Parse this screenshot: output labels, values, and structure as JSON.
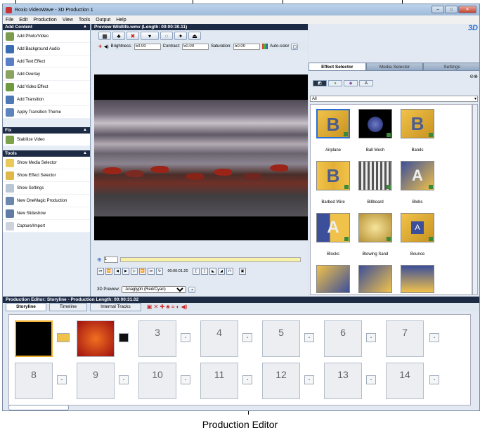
{
  "window": {
    "title": "Roxio VideoWave - 3D Production 1",
    "controls": {
      "minimize": "–",
      "maximize": "□",
      "close": "✕"
    }
  },
  "menu": [
    "File",
    "Edit",
    "Production",
    "View",
    "Tools",
    "Output",
    "Help"
  ],
  "left_panel": {
    "add_content": {
      "header": "Add Content",
      "items": [
        "Add Photo/Video",
        "Add Background Audio",
        "Add Text Effect",
        "Add Overlay",
        "Add Video Effect",
        "Add Transition",
        "Apply Transition Theme"
      ]
    },
    "fix": {
      "header": "Fix",
      "items": [
        "Stabilize Video"
      ]
    },
    "tools": {
      "header": "Tools",
      "items": [
        "Show Media Selector",
        "Show Effect Selector",
        "Show Settings",
        "New OneMagic Production",
        "New Slideshow",
        "Capture/Import"
      ]
    }
  },
  "preview": {
    "header": "Preview  Wildlife.wmv (Length: 00:00:30.11)",
    "brightness_label": "Brightness:",
    "brightness_value": "50.00",
    "contrast_label": "Contrast:",
    "contrast_value": "50.00",
    "saturation_label": "Saturation:",
    "saturation_value": "50.00",
    "autocolor_label": "Auto-color",
    "frame_value": "1",
    "timecode": "00:00:01.20",
    "p3d_label": "3D Preview:",
    "p3d_value": "Anaglyph (Red/Cyan)"
  },
  "right_panel": {
    "brand": "3D",
    "tabs": [
      "Effect Selector",
      "Media Selector",
      "Settings"
    ],
    "filter_value": "All",
    "effects": [
      "Airplane",
      "Ball Mesh",
      "Bands",
      "Barbed Wire",
      "Billboard",
      "Blobs",
      "Blocks",
      "Blowing Sand",
      "Bounce"
    ]
  },
  "production_editor": {
    "header": "Production Editor: Storyline - Production Length: 00:00:31.02",
    "tabs": [
      "Storyline",
      "Timeline",
      "Internal Tracks"
    ],
    "slots": [
      "3",
      "4",
      "5",
      "6",
      "7",
      "8",
      "9",
      "10",
      "11",
      "12",
      "13",
      "14"
    ]
  },
  "callout": "Production Editor",
  "colors": {
    "panel_header": "#1c2a44",
    "panel_bg": "#e2e9f2",
    "accent": "#2a6fd1"
  }
}
